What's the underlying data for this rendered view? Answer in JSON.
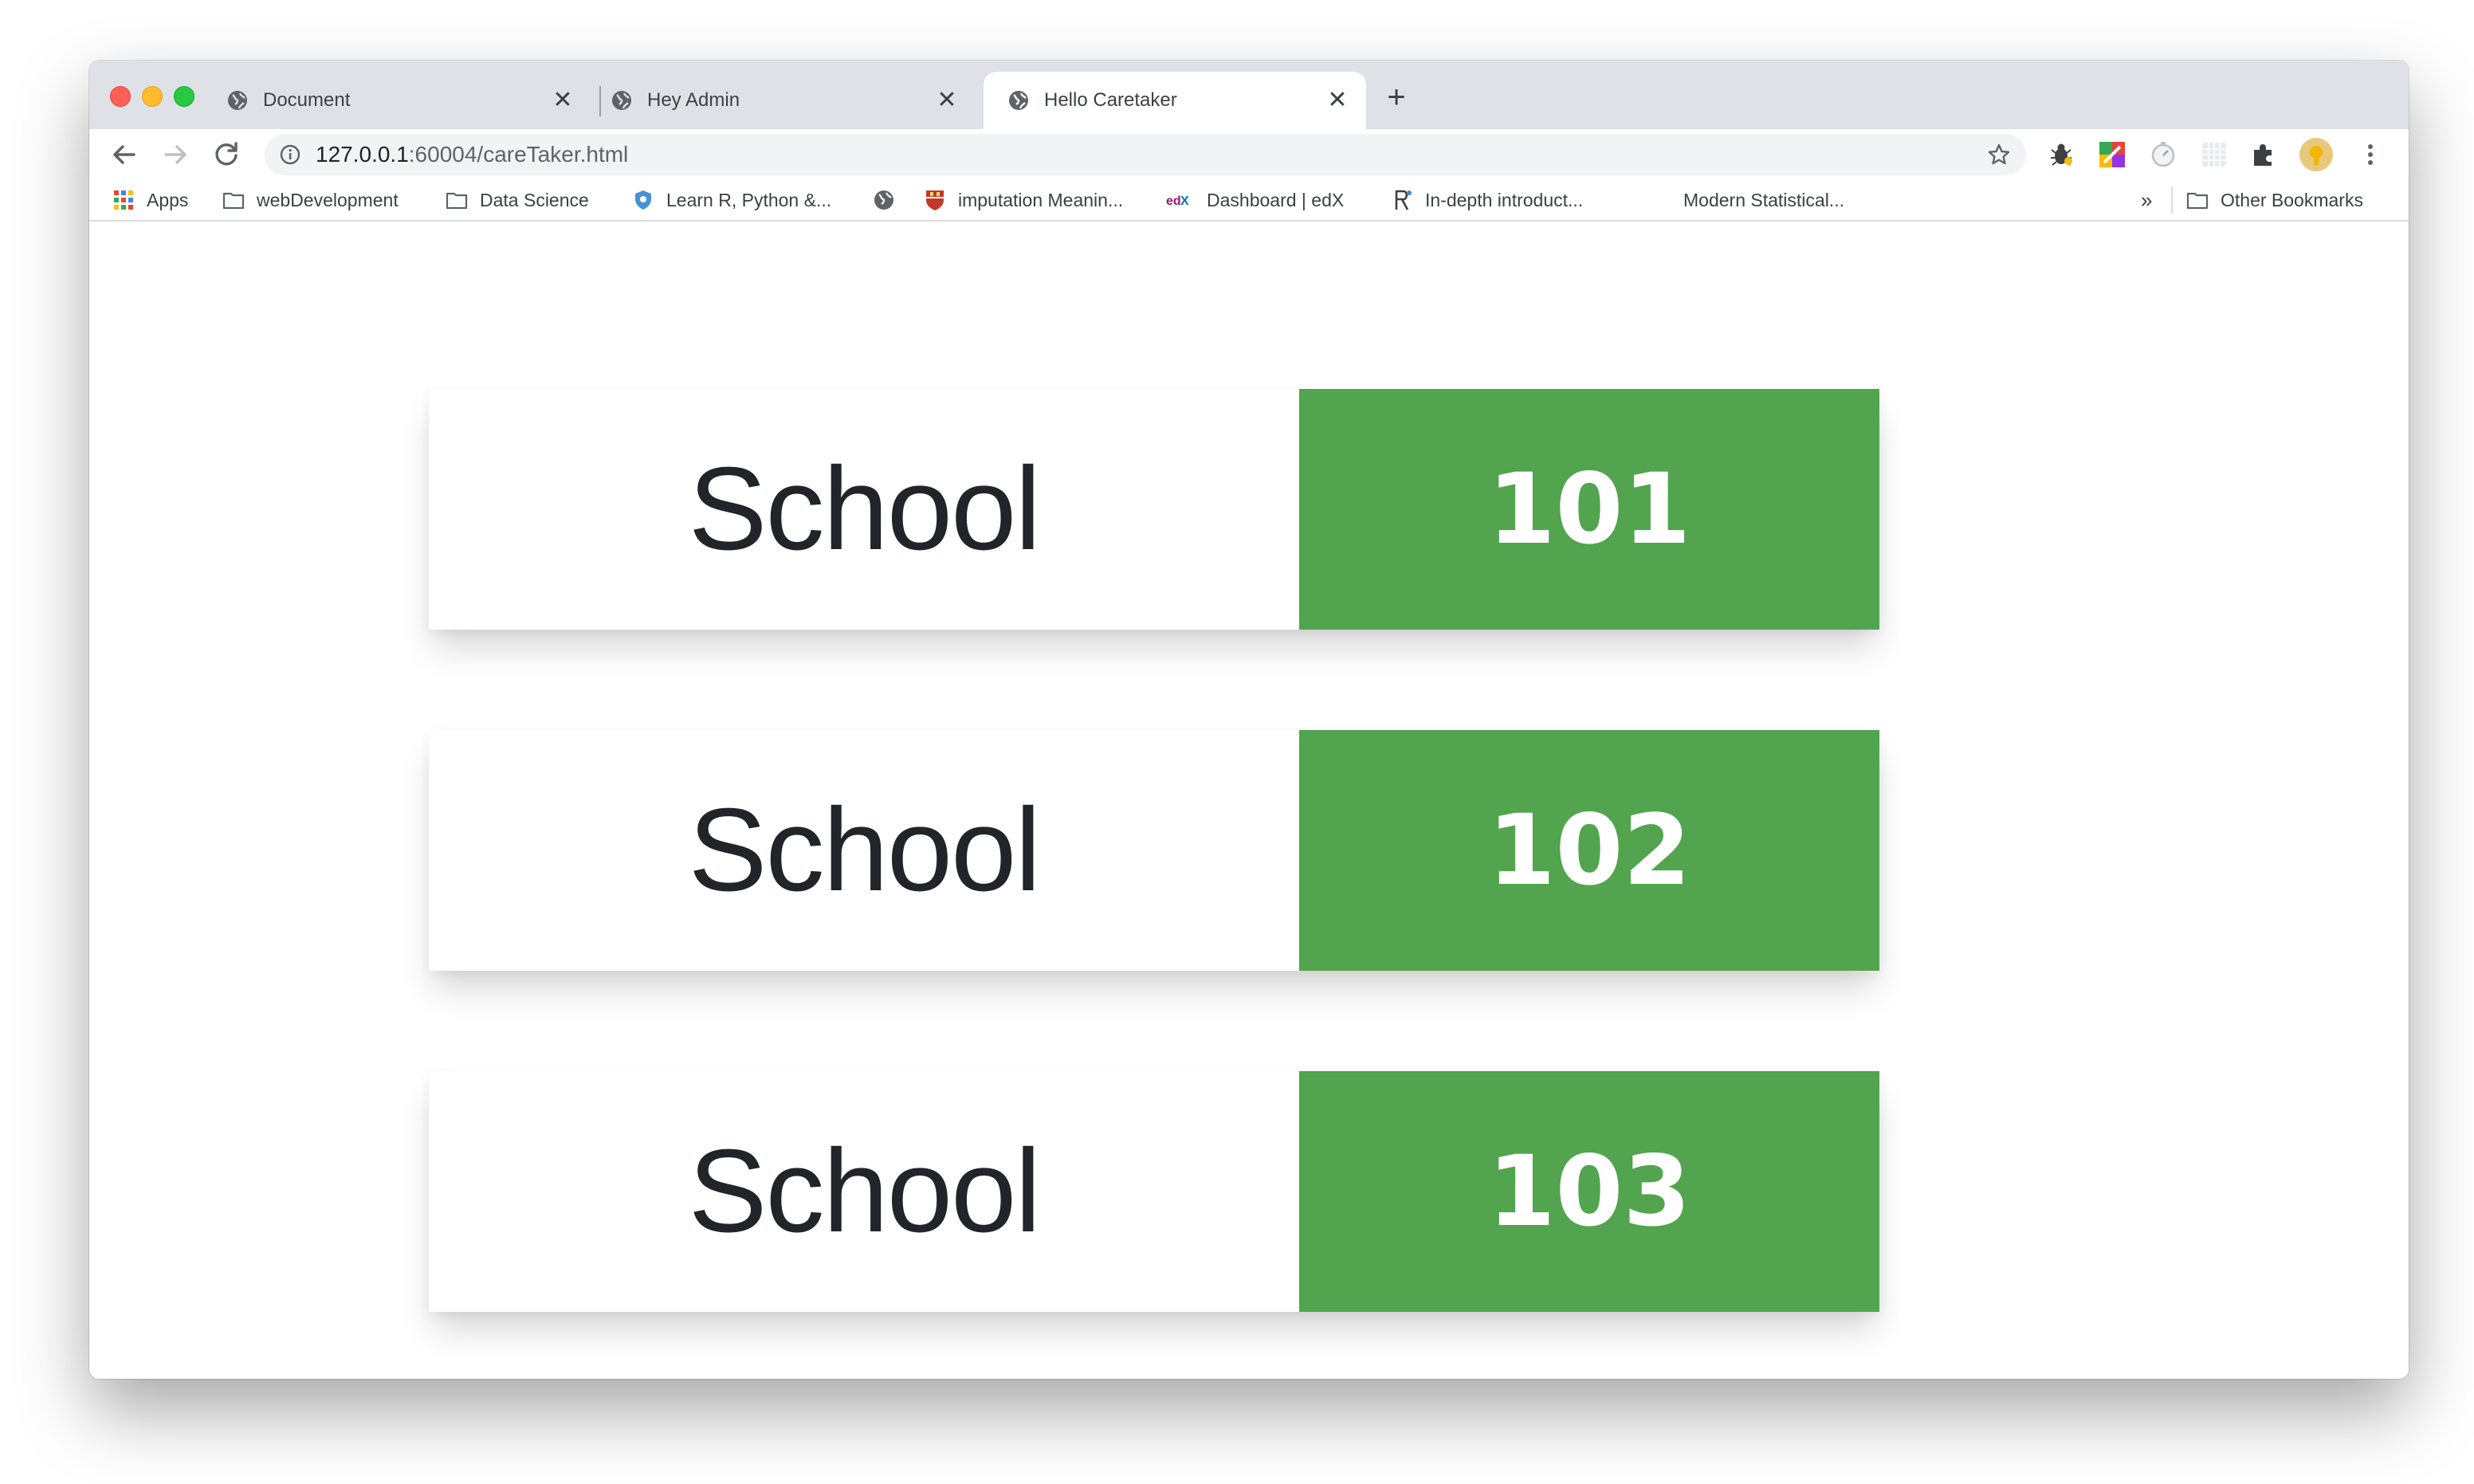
{
  "browser": {
    "tabs": [
      {
        "title": "Document",
        "close": "✕"
      },
      {
        "title": "Hey Admin",
        "close": "✕"
      },
      {
        "title": "Hello Caretaker",
        "close": "✕"
      }
    ],
    "new_tab": "+",
    "address": {
      "host": "127.0.0.1",
      "path": ":60004/careTaker.html"
    },
    "bookmarks": [
      {
        "label": "Apps",
        "icon": "apps-grid-icon"
      },
      {
        "label": "webDevelopment",
        "icon": "folder-icon"
      },
      {
        "label": "Data Science",
        "icon": "folder-icon"
      },
      {
        "label": "Learn R, Python &...",
        "icon": "shield-icon"
      },
      {
        "label": "",
        "icon": "globe-icon"
      },
      {
        "label": "imputation Meanin...",
        "icon": "crest-icon"
      },
      {
        "label": "Dashboard | edX",
        "icon": "edx-icon"
      },
      {
        "label": "In-depth introduct...",
        "icon": "r-logo-icon"
      },
      {
        "label": "Modern Statistical...",
        "icon": ""
      },
      {
        "label": "Other Bookmarks",
        "icon": "folder-icon"
      }
    ],
    "bookmarks_overflow": "»"
  },
  "cards": [
    {
      "label": "School",
      "number": "101"
    },
    {
      "label": "School",
      "number": "102"
    },
    {
      "label": "School",
      "number": "103"
    }
  ],
  "colors": {
    "card_accent": "#52a44e",
    "tabstrip": "#dee1e6"
  }
}
